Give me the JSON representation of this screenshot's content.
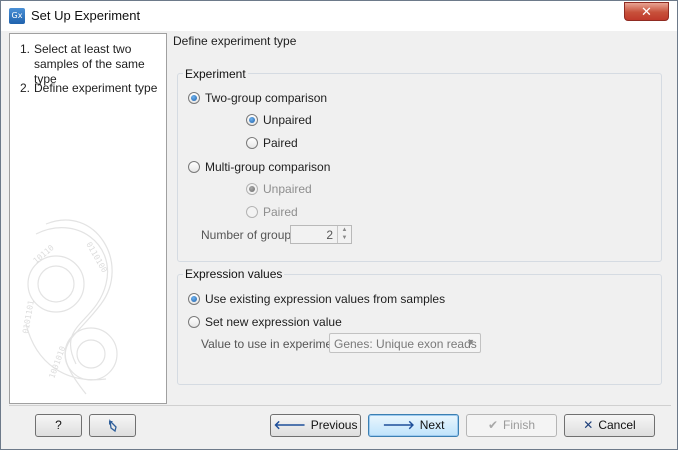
{
  "window": {
    "title": "Set Up Experiment",
    "app_icon_text": "Gx",
    "close_glyph": "✕"
  },
  "steps": [
    {
      "num": "1.",
      "label": "Select at least two samples of the same type"
    },
    {
      "num": "2.",
      "label": "Define experiment type"
    }
  ],
  "content": {
    "header": "Define experiment type",
    "experiment": {
      "title": "Experiment",
      "two_group": "Two-group comparison",
      "two_group_unpaired": "Unpaired",
      "two_group_paired": "Paired",
      "multi_group": "Multi-group comparison",
      "multi_group_unpaired": "Unpaired",
      "multi_group_paired": "Paired",
      "num_groups_label": "Number of groups",
      "num_groups_value": "2"
    },
    "expression": {
      "title": "Expression values",
      "use_existing": "Use existing expression values from samples",
      "set_new": "Set new expression value",
      "value_label": "Value to use in experiment",
      "value_selected": "Genes: Unique exon reads"
    }
  },
  "buttons": {
    "help": "?",
    "previous": "Previous",
    "next": "Next",
    "finish": "Finish",
    "cancel": "Cancel"
  },
  "icons": {
    "help": "question-mark-icon",
    "reset": "undo-icon",
    "previous": "arrow-left-icon",
    "next": "arrow-right-icon",
    "finish": "checkmark-icon",
    "cancel": "x-icon"
  },
  "colors": {
    "accent": "#1e5fa8",
    "close_button": "#c7503a"
  }
}
